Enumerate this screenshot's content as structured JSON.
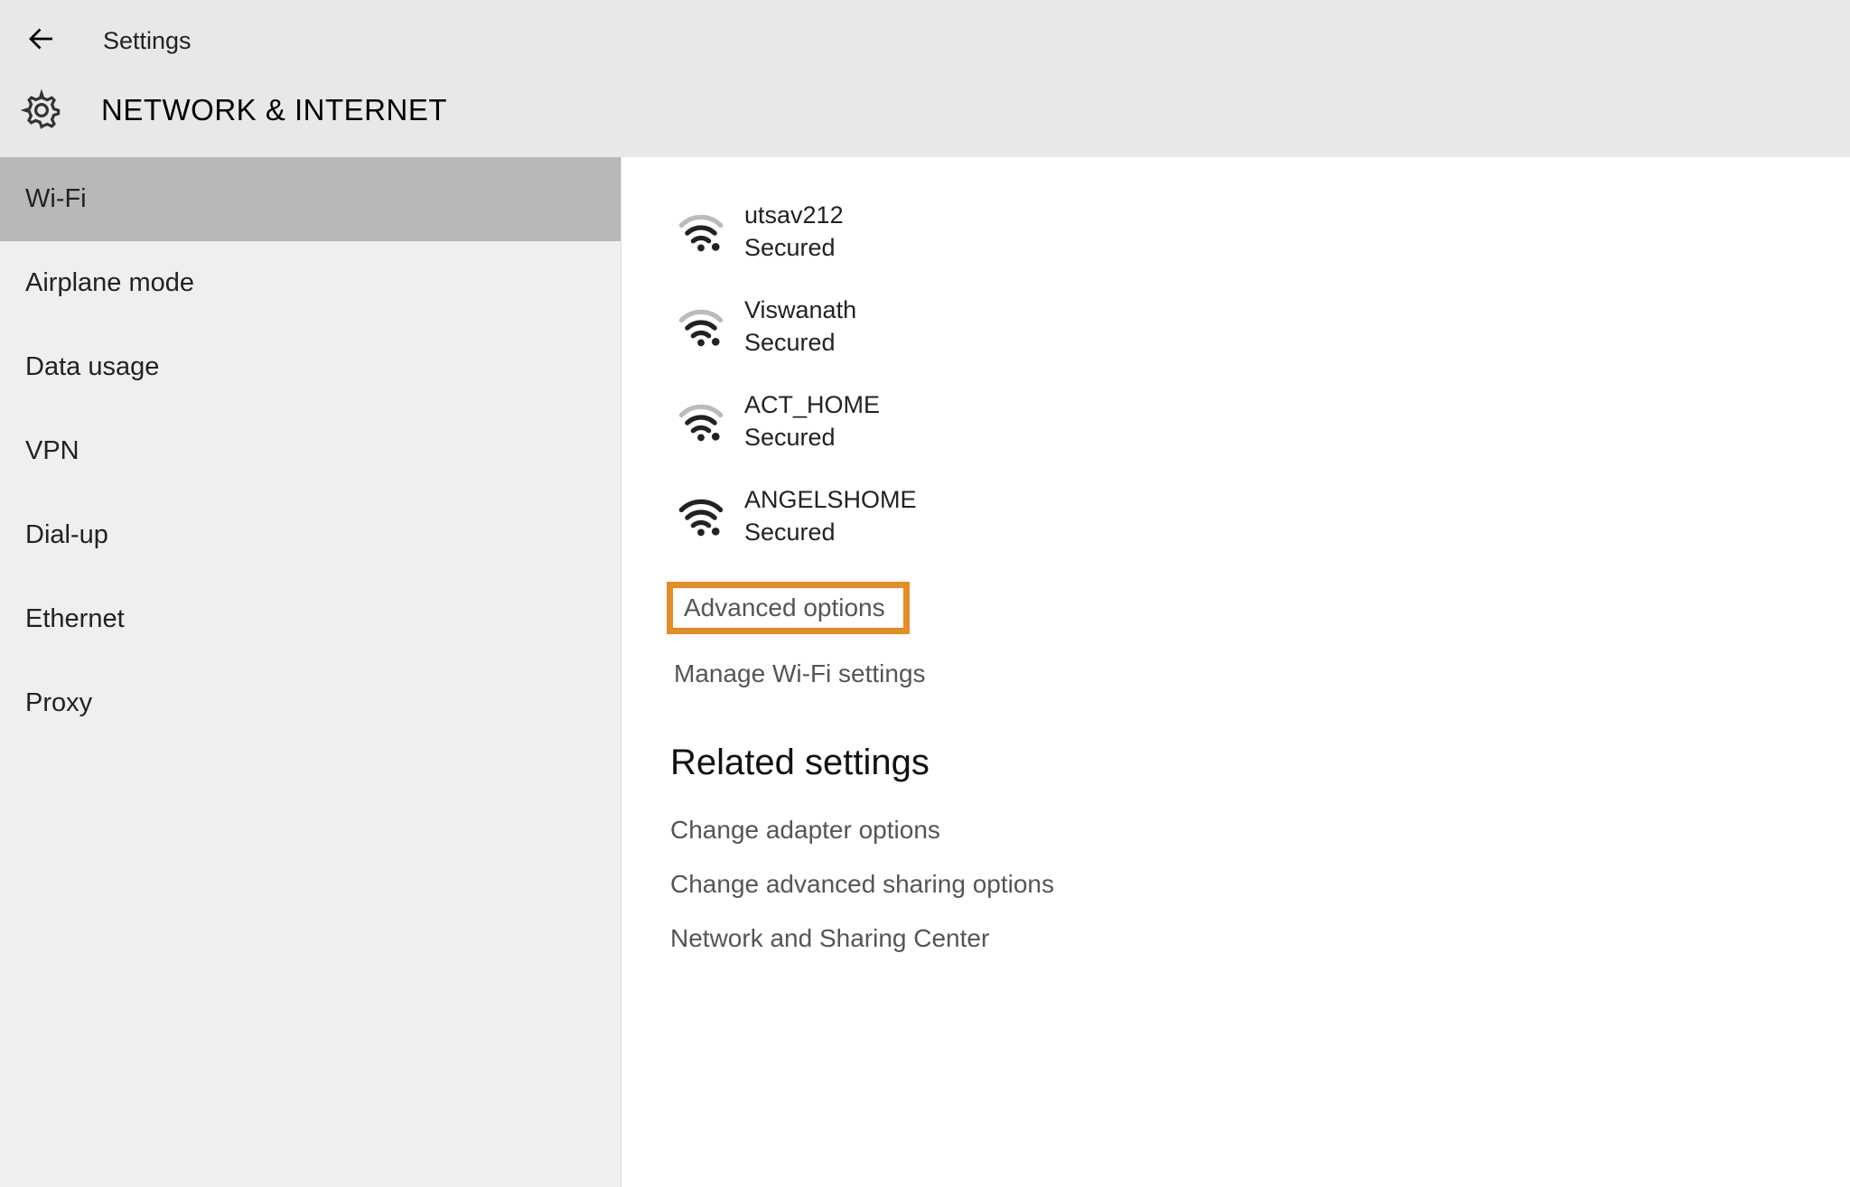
{
  "header": {
    "app_title": "Settings",
    "page_title": "NETWORK & INTERNET"
  },
  "sidebar": {
    "items": [
      {
        "label": "Wi-Fi",
        "selected": true
      },
      {
        "label": "Airplane mode",
        "selected": false
      },
      {
        "label": "Data usage",
        "selected": false
      },
      {
        "label": "VPN",
        "selected": false
      },
      {
        "label": "Dial-up",
        "selected": false
      },
      {
        "label": "Ethernet",
        "selected": false
      },
      {
        "label": "Proxy",
        "selected": false
      }
    ]
  },
  "networks": [
    {
      "name": "utsav212",
      "status": "Secured"
    },
    {
      "name": "Viswanath",
      "status": "Secured"
    },
    {
      "name": "ACT_HOME",
      "status": "Secured"
    },
    {
      "name": "ANGELSHOME",
      "status": "Secured"
    }
  ],
  "links": {
    "advanced_options": "Advanced options",
    "manage_wifi": "Manage Wi-Fi settings"
  },
  "related": {
    "heading": "Related settings",
    "items": [
      "Change adapter options",
      "Change advanced sharing options",
      "Network and Sharing Center"
    ]
  },
  "highlight_color": "#e48c25"
}
